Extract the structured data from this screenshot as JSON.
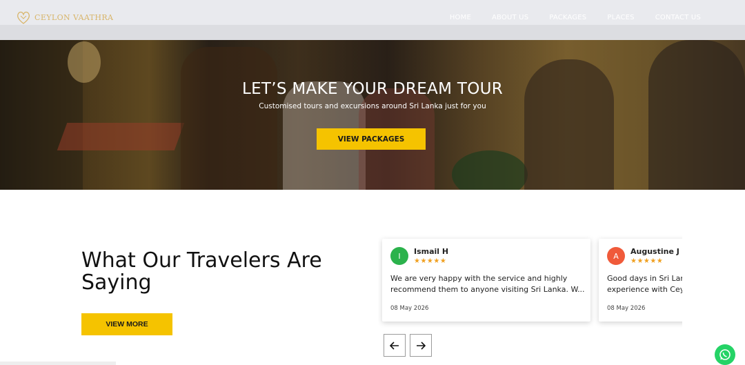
{
  "header": {
    "logo_text": "CEYLON VAATHRA",
    "nav": [
      "HOME",
      "ABOUT US",
      "PACKAGES",
      "PLACES",
      "CONTACT US"
    ]
  },
  "hero": {
    "title": "LET’S MAKE YOUR DREAM TOUR",
    "subtitle": "Customised tours and excursions around Sri Lanka just for you",
    "button": "VIEW PACKAGES"
  },
  "testimonials": {
    "title": "What Our Travelers Are Saying",
    "view_more": "VIEW MORE",
    "reviews": [
      {
        "initial": "I",
        "name": "Ismail H",
        "stars": "★★★★★",
        "text_line1": "We are very happy with the service and highly",
        "text_line2": "recommend them to anyone visiting Sri Lanka. W...",
        "date": "08 May 2026",
        "avatar_color": "#2bb24c"
      },
      {
        "initial": "A",
        "name": "Augustine J",
        "stars": "★★★★★",
        "text_line1": "Good days in Sri Lanka",
        "text_line2": "experience with Ceylon",
        "date": "08 May 2026",
        "avatar_color": "#f05a3a"
      }
    ],
    "prev_icon": "arrow-left-icon",
    "next_icon": "arrow-right-icon"
  },
  "colors": {
    "accent": "#f5c300",
    "logo": "#d8b56a",
    "whatsapp": "#25d366"
  }
}
